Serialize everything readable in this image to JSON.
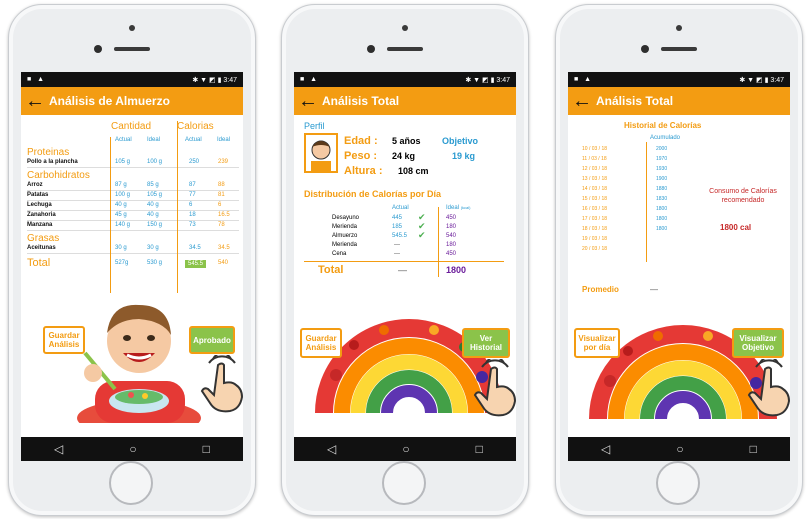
{
  "statusbar": {
    "icons_left": "■ ▲",
    "icons_right": "✱ ▼ ◩ ▮",
    "time": "3:47"
  },
  "screen1": {
    "title": "Análisis de Almuerzo",
    "col_cantidad": "Cantidad",
    "col_calorias": "Calorias",
    "sub_actual": "Actual",
    "sub_ideal": "Ideal",
    "sections": [
      {
        "name": "Proteinas",
        "rows": [
          {
            "n": "Pollo a la plancha",
            "a": "105 g",
            "b": "100 g",
            "c": "250",
            "d": "239"
          }
        ]
      },
      {
        "name": "Carbohidratos",
        "rows": [
          {
            "n": "Arroz",
            "a": "87 g",
            "b": "85 g",
            "c": "87",
            "d": "88"
          },
          {
            "n": "Patatas",
            "a": "100 g",
            "b": "105 g",
            "c": "77",
            "d": "81"
          },
          {
            "n": "Lechuga",
            "a": "40 g",
            "b": "40 g",
            "c": "6",
            "d": "6"
          },
          {
            "n": "Zanahoria",
            "a": "45 g",
            "b": "40 g",
            "c": "18",
            "d": "16.5"
          },
          {
            "n": "Manzana",
            "a": "140 g",
            "b": "150 g",
            "c": "73",
            "d": "78"
          }
        ]
      },
      {
        "name": "Grasas",
        "rows": [
          {
            "n": "Aceitunas",
            "a": "30 g",
            "b": "30 g",
            "c": "34.5",
            "d": "34.5"
          }
        ]
      }
    ],
    "total_label": "Total",
    "total_a": "527g",
    "total_b": "530 g",
    "total_c": "545.5",
    "total_d": "540",
    "btn_guardar": "Guardar Análisis",
    "btn_aprobado": "Aprobado"
  },
  "screen2": {
    "title": "Análisis Total",
    "perfil": "Perfil",
    "edad_label": "Edad :",
    "edad_val": "5 años",
    "objetivo_label": "Objetivo",
    "objetivo_val": "19 kg",
    "peso_label": "Peso :",
    "peso_val": "24 kg",
    "altura_label": "Altura :",
    "altura_val": "108 cm",
    "dist_title": "Distribución de Calorías por Día",
    "col_actual": "Actual",
    "col_ideal": "Ideal",
    "col_ideal_unit": "(kcal)",
    "meals": [
      {
        "n": "Desayuno",
        "a": "445",
        "check": "✔",
        "i": "450"
      },
      {
        "n": "Merienda",
        "a": "185",
        "check": "✔",
        "i": "180"
      },
      {
        "n": "Almuerzo",
        "a": "545.5",
        "check": "✔",
        "i": "540"
      },
      {
        "n": "Merienda",
        "a": "—",
        "check": "",
        "i": "180"
      },
      {
        "n": "Cena",
        "a": "—",
        "check": "",
        "i": "450"
      }
    ],
    "total_label": "Total",
    "total_a": "—",
    "total_i": "1800",
    "btn_guardar": "Guardar Análisis",
    "btn_historial": "Ver Historial"
  },
  "screen3": {
    "title": "Análisis Total",
    "hist_title": "Historial de Calorías",
    "col_acumulado": "Acumulado",
    "rows": [
      {
        "d": "10 / 03 / 18",
        "v": "2000"
      },
      {
        "d": "11 / 03 / 18",
        "v": "1970"
      },
      {
        "d": "12 / 03 / 18",
        "v": "1930"
      },
      {
        "d": "13 / 03 / 18",
        "v": "1900"
      },
      {
        "d": "14 / 03 / 18",
        "v": "1880"
      },
      {
        "d": "15 / 03 / 18",
        "v": "1830"
      },
      {
        "d": "16 / 03 / 18",
        "v": "1800"
      },
      {
        "d": "17 / 03 / 18",
        "v": "1800"
      },
      {
        "d": "18 / 03 / 18",
        "v": "1800"
      },
      {
        "d": "19 / 03 / 18",
        "v": ""
      },
      {
        "d": "20 / 03 / 18",
        "v": ""
      }
    ],
    "consumo": "Consumo de Calorías recomendado",
    "consumo_val": "1800 cal",
    "promedio": "Promedio",
    "promedio_val": "—",
    "btn_visualizar_dia": "Visualizar por día",
    "btn_visualizar_obj": "Visualizar Objetivo"
  }
}
